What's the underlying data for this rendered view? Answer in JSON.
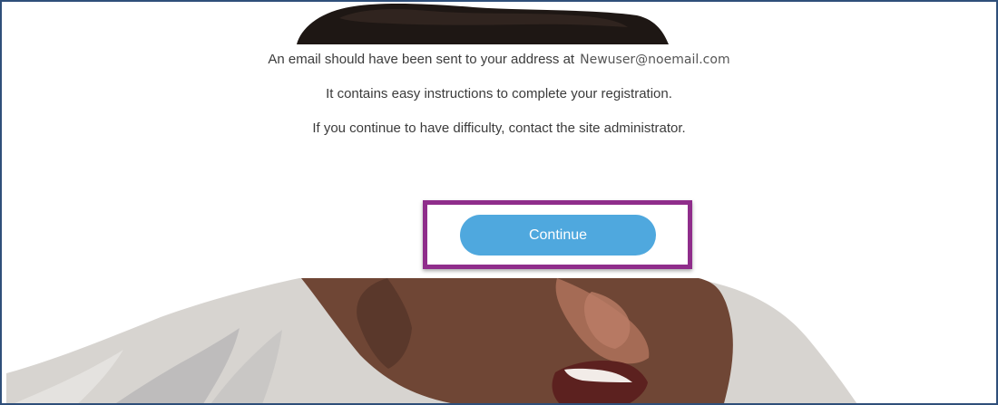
{
  "message": {
    "line1_prefix": "An email should have been sent to your address at",
    "email": "Newuser@noemail.com",
    "line2": "It contains easy instructions to complete your registration.",
    "line3": "If you continue to have difficulty, contact the site administrator."
  },
  "actions": {
    "continue_label": "Continue"
  },
  "colors": {
    "button": "#4fa8de",
    "highlight": "#8f2d8b",
    "frame": "#2f4f7a"
  },
  "background": {
    "subject": "smiling-baby-photo"
  }
}
